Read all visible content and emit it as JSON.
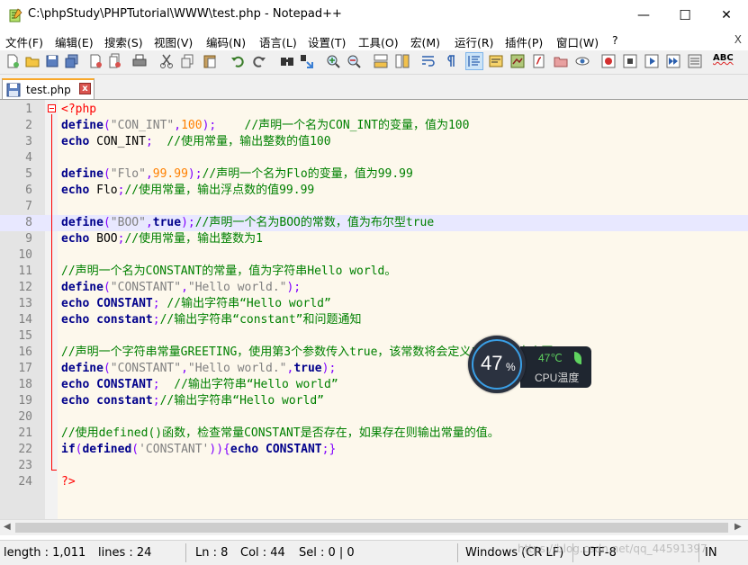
{
  "window": {
    "title": "C:\\phpStudy\\PHPTutorial\\WWW\\test.php - Notepad++",
    "minimize_glyph": "—",
    "maximize_glyph": "☐",
    "close_glyph": "✕"
  },
  "menu": {
    "items": [
      "文件(F)",
      "编辑(E)",
      "搜索(S)",
      "视图(V)",
      "编码(N)",
      "语言(L)",
      "设置(T)",
      "工具(O)",
      "宏(M)",
      "运行(R)",
      "插件(P)",
      "窗口(W)",
      "?"
    ],
    "close_label": "X"
  },
  "toolbar": {
    "icons": [
      "new-file-icon",
      "open-file-icon",
      "save-icon",
      "save-all-icon",
      "close-icon",
      "close-all-icon",
      "print-icon",
      "cut-icon",
      "copy-icon",
      "paste-icon",
      "undo-icon",
      "redo-icon",
      "find-icon",
      "replace-icon",
      "zoom-in-icon",
      "zoom-out-icon",
      "sync-vertical-icon",
      "sync-horizontal-icon",
      "word-wrap-icon",
      "show-all-chars-icon",
      "indent-guide-icon",
      "udl-icon",
      "doc-map-icon",
      "function-list-icon",
      "folder-workspace-icon",
      "monitor-icon",
      "record-macro-icon",
      "stop-macro-icon",
      "play-macro-icon",
      "run-macro-multiple-icon",
      "save-macro-icon",
      "spellcheck-icon"
    ],
    "spellcheck_text": "ABC"
  },
  "tab": {
    "label": "test.php",
    "close_glyph": "x"
  },
  "editor": {
    "line_numbers": [
      "1",
      "2",
      "3",
      "4",
      "5",
      "6",
      "7",
      "8",
      "9",
      "10",
      "11",
      "12",
      "13",
      "14",
      "15",
      "16",
      "17",
      "18",
      "19",
      "20",
      "21",
      "22",
      "23",
      "24"
    ],
    "current_line": 8
  },
  "status": {
    "length": "length : 1,011",
    "lines": "lines : 24",
    "ln": "Ln : 8",
    "col": "Col : 44",
    "sel": "Sel : 0 | 0",
    "eol": "Windows (CR LF)",
    "encoding": "UTF-8",
    "mode": "IN"
  },
  "cpu_widget": {
    "usage_value": "47",
    "usage_unit": "%",
    "temperature": "47℃",
    "label": "CPU温度",
    "accent": "#3a9fe6",
    "temp_color": "#5fd35f"
  },
  "watermark": "https://blog.csdn.net/qq_44591397"
}
